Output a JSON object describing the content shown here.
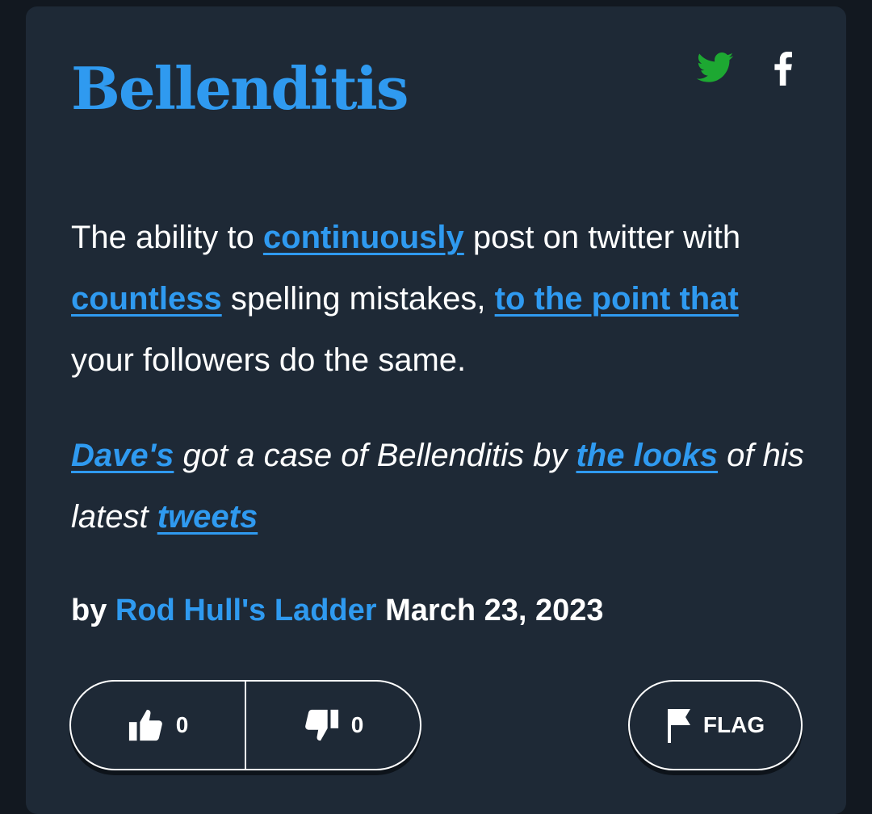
{
  "entry": {
    "word": "Bellenditis",
    "meaning": {
      "t1": "The ability to ",
      "l1": "continuously",
      "t2": " post on twitter with ",
      "l2": "countless",
      "t3": " spelling mistakes, ",
      "l3": "to the point that",
      "t4": " your followers do the same."
    },
    "example": {
      "l1": "Dave's",
      "t1": " got a case of Bellenditis by ",
      "l2": "the looks",
      "t2": " of his latest ",
      "l3": "tweets"
    },
    "contributor": {
      "by": "by",
      "author": "Rod Hull's Ladder",
      "date": "March 23, 2023"
    }
  },
  "share": {
    "twitter_icon": "twitter-bird-icon",
    "facebook_icon": "facebook-f-icon"
  },
  "votes": {
    "up_count": "0",
    "down_count": "0",
    "up_icon": "thumbs-up-icon",
    "down_icon": "thumbs-down-icon"
  },
  "flag": {
    "label": "FLAG",
    "icon": "flag-icon"
  },
  "colors": {
    "background": "#121820",
    "card": "#1e2936",
    "accent": "#2f9af0",
    "twitter": "#1da832",
    "text": "#ffffff"
  }
}
